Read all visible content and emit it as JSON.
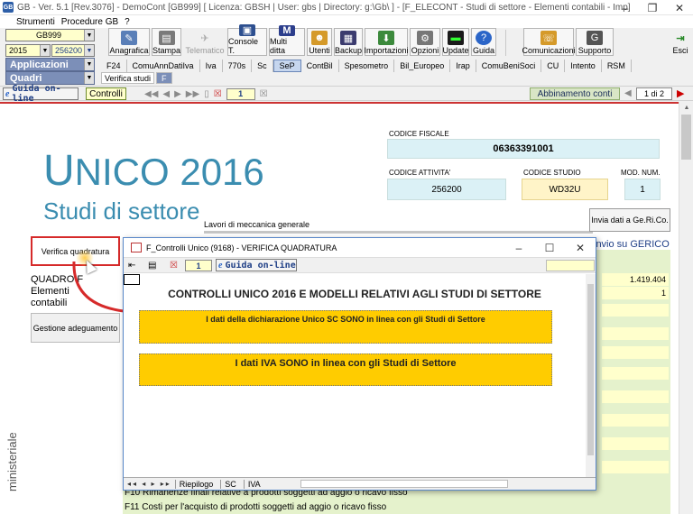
{
  "window": {
    "title": "GB - Ver. 5.1 [Rev.3076] - DemoCont [GB999]   [ Licenza: GBSH | User: gbs | Directory: g:\\Gb\\ ] - [F_ELECONT - Studi di settore - Elementi contabili - Imp]",
    "minimize": "–",
    "restore": "❐",
    "close": "✕"
  },
  "menu": [
    "Strumenti",
    "Procedure GB",
    "?"
  ],
  "left_panel": {
    "company_code": "GB999",
    "year": "2015",
    "code2": "256200 -",
    "section1": "Applicazioni",
    "section2": "Quadri"
  },
  "toolbar": [
    {
      "label": "Anagrafica",
      "icon": "address-book-icon"
    },
    {
      "label": "Stampa",
      "icon": "printer-icon"
    },
    {
      "label": "Telematico",
      "icon": "telematico-icon"
    },
    {
      "label": "Console T.",
      "icon": "console-icon"
    },
    {
      "label": "Multi ditta",
      "icon": "multi-company-icon"
    },
    {
      "label": "Utenti",
      "icon": "users-icon"
    },
    {
      "label": "Backup",
      "icon": "backup-icon"
    },
    {
      "label": "Importazioni",
      "icon": "import-icon"
    },
    {
      "label": "Opzioni",
      "icon": "options-icon"
    },
    {
      "label": "Update",
      "icon": "update-icon"
    },
    {
      "label": "Guida",
      "icon": "help-icon"
    },
    {
      "label": "Comunicazioni",
      "icon": "communications-icon"
    },
    {
      "label": "Supporto",
      "icon": "support-icon"
    },
    {
      "label": "Esci",
      "icon": "exit-icon"
    }
  ],
  "tabs": [
    "F24",
    "ComuAnnDatiIva",
    "Iva",
    "770s",
    "Sc",
    "SeP",
    "ContBil",
    "Spesometro",
    "Bil_Europeo",
    "Irap",
    "ComuBeniSoci",
    "CU",
    "Intento",
    "RSM"
  ],
  "subtabs": [
    "Verifica studi",
    "F"
  ],
  "guidebar": {
    "guida": "Guida on-line",
    "controlli": "Controlli",
    "page_num": "1",
    "abbinamento": "Abbinamento conti",
    "page_indicator": "1 di 2"
  },
  "form": {
    "unico_title": "NICO 2016",
    "unico_first": "U",
    "studi": "Studi di settore",
    "codice_fiscale_label": "CODICE FISCALE",
    "codice_fiscale": "06363391001",
    "codice_attivita_label": "CODICE ATTIVITA'",
    "codice_attivita": "256200",
    "codice_studio_label": "CODICE STUDIO",
    "codice_studio": "WD32U",
    "mod_num_label": "MOD. NUM.",
    "mod_num": "1",
    "lavori": "Lavori di meccanica generale",
    "invio_btn": "Invia dati a Ge.Ri.Co.",
    "verifica_btn": "Verifica quadratura",
    "gestione_btn": "Gestione adeguamento",
    "quadro_f_1": "QUADRO F",
    "quadro_f_2": "Elementi",
    "quadro_f_3": "contabili",
    "invio_gerico": "invio su GERICO",
    "ministeriale": "ministeriale",
    "value1": "1.419.404",
    "value2": "1",
    "row_f10": "F10   Rimanenze finali relative a prodotti soggetti ad aggio o ricavo fisso",
    "row_f11": "F11   Costi per l'acquisto di prodotti soggetti ad aggio o ricavo fisso"
  },
  "dialog": {
    "title": "F_Controlli Unico (9168) - VERIFICA QUADRATURA",
    "minimize": "–",
    "maximize": "☐",
    "close": "✕",
    "page_num": "1",
    "guida": "Guida on-line",
    "heading": "CONTROLLI UNICO 2016 E MODELLI RELATIVI AGLI STUDI DI SETTORE",
    "msg1": "I dati della dichiarazione Unico SC  SONO  in linea con gli Studi di Settore",
    "msg2": "I dati IVA SONO in linea con gli Studi di Settore",
    "sheet_nav": "◂◂ ◂ ▸ ▸▸",
    "sheets": [
      "Riepilogo",
      "SC",
      "IVA"
    ]
  },
  "colors": {
    "accent_blue": "#3b8db0",
    "message_yellow": "#ffcc00",
    "highlight_red": "#d62a2a",
    "panel_green": "#e5f2cc"
  }
}
